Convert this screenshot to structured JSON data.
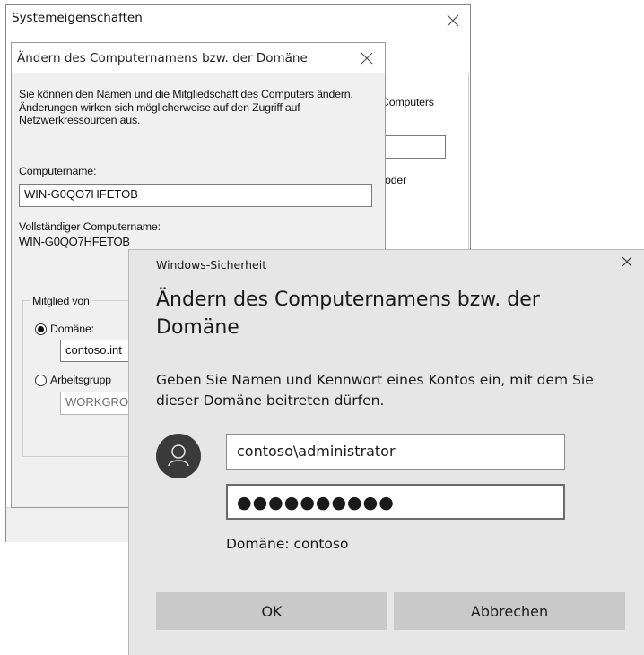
{
  "system_properties": {
    "title": "Systemeigenschaften",
    "behind_text_computers": "Computers",
    "behind_text_oder": "oder"
  },
  "rename_dialog": {
    "title": "Ändern des Computernamens bzw. der Domäne",
    "intro": "Sie können den Namen und die Mitgliedschaft des Computers ändern. Änderungen wirken sich möglicherweise auf den Zugriff auf Netzwerkressourcen aus.",
    "computer_name_label": "Computername:",
    "computer_name_value": "WIN-G0QO7HFETOB",
    "full_name_label": "Vollständiger Computername:",
    "full_name_value": "WIN-G0QO7HFETOB",
    "member_of_label": "Mitglied von",
    "domain_radio_label": "Domäne:",
    "domain_value": "contoso.int",
    "workgroup_radio_label": "Arbeitsgrupp",
    "workgroup_value": "WORKGRO",
    "selected": "domain"
  },
  "security_dialog": {
    "app_title": "Windows-Sicherheit",
    "heading": "Ändern des Computernamens bzw. der Domäne",
    "description": "Geben Sie Namen und Kennwort eines Kontos ein, mit dem Sie dieser Domäne beitreten dürfen.",
    "username_value": "contoso\\administrator",
    "password_masked": "●●●●●●●●●●",
    "domain_text": "Domäne: contoso",
    "ok_label": "OK",
    "cancel_label": "Abbrechen",
    "close_glyph": "✕"
  },
  "icons": {
    "avatar": "user-icon",
    "close": "close-icon",
    "radio_selected": "radio-selected",
    "radio_unselected": "radio-unselected"
  }
}
